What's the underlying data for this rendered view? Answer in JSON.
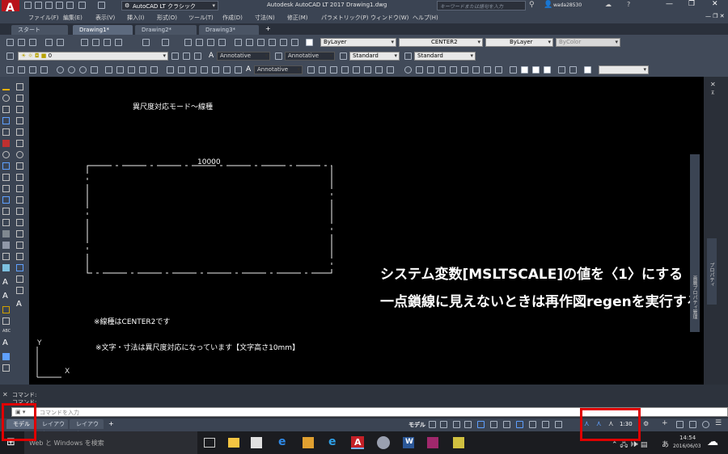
{
  "titlebar": {
    "workspace": "AutoCAD LT クラシック",
    "title": "Autodesk AutoCAD LT 2017   Drawing1.dwg",
    "search_placeholder": "キーワードまたは語句を入力",
    "user": "wada28530"
  },
  "menu": [
    "ファイル(F)",
    "編集(E)",
    "表示(V)",
    "挿入(I)",
    "形式(O)",
    "ツール(T)",
    "作成(D)",
    "寸法(N)",
    "修正(M)",
    "パラメトリック(P)",
    "ウィンドウ(W)",
    "ヘルプ(H)"
  ],
  "tabs": {
    "start": "スタート",
    "items": [
      "Drawing1*",
      "Drawing2*",
      "Drawing3*"
    ],
    "add": "+"
  },
  "ribbon": {
    "layer_value": "ByLayer",
    "linetype_value": "CENTER2",
    "lineweight_value": "ByLayer",
    "color_value": "ByColor",
    "current_layer": "0",
    "annotative1": "Annotative",
    "annotative2": "Annotative",
    "text_style": "Standard",
    "dim_style": "Standard",
    "annotative3": "Annotative"
  },
  "canvas": {
    "heading": "異尺度対応モード～線種",
    "dimension": "10000",
    "note1": "※線種はCENTER2です",
    "note2": "※文字・寸法は異尺度対応になっています【文字高さ10mm】",
    "big1": "システム変数[MSLTSCALE]の値を〈1〉にする",
    "big2": "一点鎖線に見えないときは再作図regenを実行する",
    "ucs_y": "Y",
    "ucs_x": "X"
  },
  "command": {
    "line1": "コマンド:",
    "line2": "コマンド:",
    "placeholder": "コマンドを入力"
  },
  "layout_tabs": [
    "モデル",
    "レイアウト1",
    "レイアウト2"
  ],
  "status": {
    "model": "モデル",
    "scale": "1:30"
  },
  "properties_panel": "プロパティ",
  "properties_panel2": "画層プロパティ管理",
  "taskbar": {
    "search": "Web と Windows を検索",
    "time": "14:54",
    "date": "2016/06/03",
    "ime": "あ"
  },
  "colors": {
    "accent": "#e00000",
    "cad_bg": "#000000"
  }
}
